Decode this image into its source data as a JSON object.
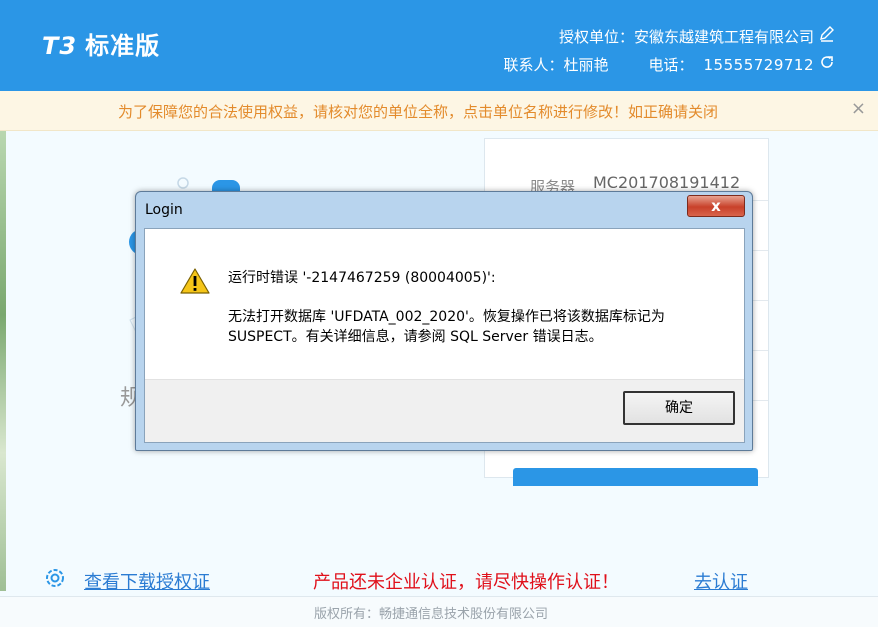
{
  "header": {
    "logo_mark": "T3",
    "logo_text": "标准版",
    "org_label": "授权单位：",
    "org_name": "安徽东越建筑工程有限公司",
    "contact_label": "联系人：",
    "contact_name": "杜丽艳",
    "phone_label": "电话：",
    "phone_value": "15555729712",
    "edit_icon": "edit-icon",
    "refresh_icon": "refresh-icon"
  },
  "notice": {
    "text": "为了保障您的合法使用权益，请核对您的单位全称，点击单位名称进行修改！如正确请关闭",
    "close": "×"
  },
  "background": {
    "illus_text": "规"
  },
  "login_panel": {
    "server_label": "服务器",
    "server_value": "MC201708191412"
  },
  "dialog": {
    "title": "Login",
    "close": "x",
    "error_line": "运行时错误 '-2147467259 (80004005)':",
    "message": "无法打开数据库 'UFDATA_002_2020'。恢复操作已将该数据库标记为 SUSPECT。有关详细信息，请参阅 SQL Server 错误日志。",
    "ok_label": "确定",
    "icon": "warning-icon"
  },
  "footer": {
    "auth_link": "查看下载授权证",
    "warning": "产品还未企业认证，请尽快操作认证！",
    "certify_link": "去认证",
    "copyright": "版权所有：畅捷通信息技术股份有限公司"
  },
  "colors": {
    "brand": "#2b96e6",
    "notice_text": "#e38b2c",
    "warning_text": "#e0101b",
    "link": "#2b7cd3"
  }
}
